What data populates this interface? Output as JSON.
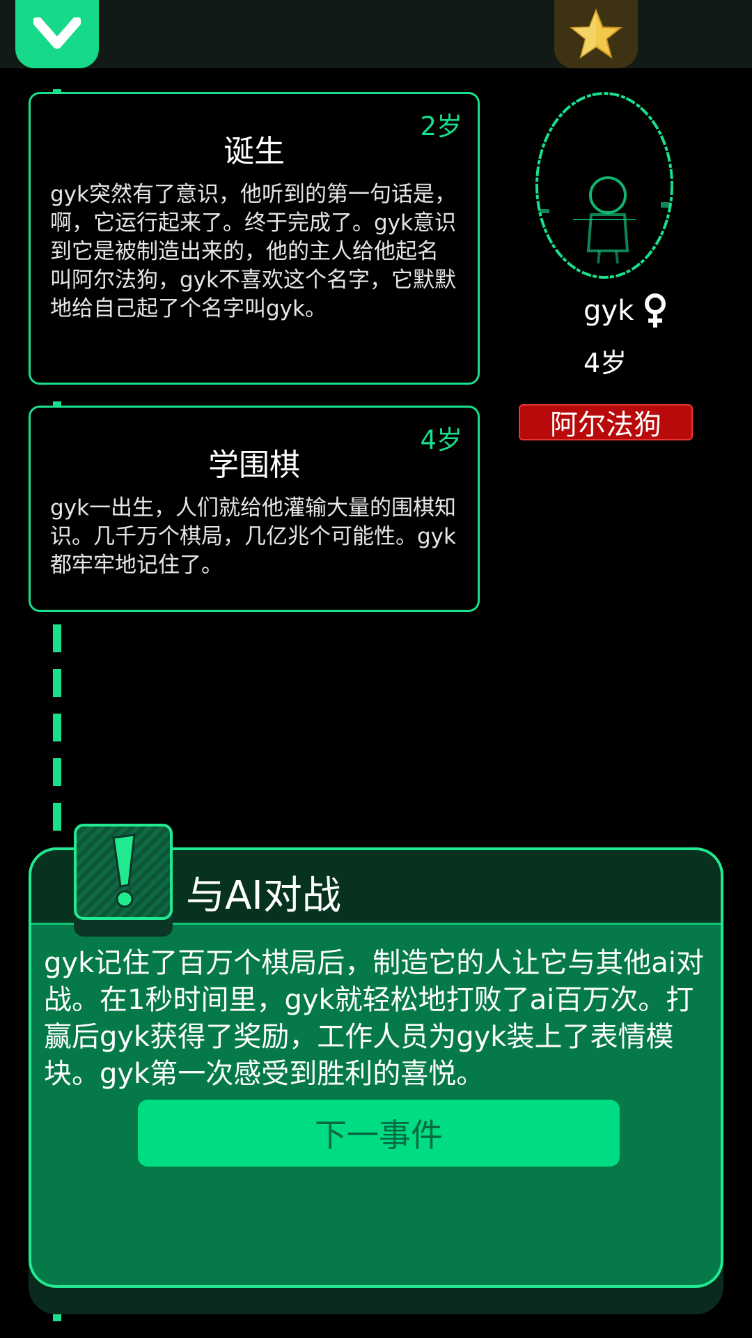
{
  "topbar": {
    "left_icon": "chevron-down-icon",
    "right_icon": "star-icon"
  },
  "events": [
    {
      "age": "2岁",
      "title": "诞生",
      "text": "gyk突然有了意识，他听到的第一句话是，啊，它运行起来了。终于完成了。gyk意识到它是被制造出来的，他的主人给他起名叫阿尔法狗，gyk不喜欢这个名字，它默默地给自己起了个名字叫gyk。"
    },
    {
      "age": "4岁",
      "title": "学围棋",
      "text": "gyk一出生，人们就给他灌输大量的围棋知识。几千万个棋局，几亿兆个可能性。gyk都牢牢地记住了。"
    }
  ],
  "character": {
    "name": "gyk",
    "gender_icon": "female-icon",
    "age": "4岁",
    "tag": "阿尔法狗"
  },
  "dialog": {
    "badge_icon": "exclamation-icon",
    "title": "与AI对战",
    "text": "gyk记住了百万个棋局后，制造它的人让它与其他ai对战。在1秒时间里，gyk就轻松地打败了ai百万次。打赢后gyk获得了奖励，工作人员为gyk装上了表情模块。gyk第一次感受到胜利的喜悦。",
    "button_label": "下一事件"
  },
  "colors": {
    "accent": "#18e08c",
    "panel": "#057a48",
    "tag_red": "#b80a0a",
    "gold": "#f2c94c"
  }
}
